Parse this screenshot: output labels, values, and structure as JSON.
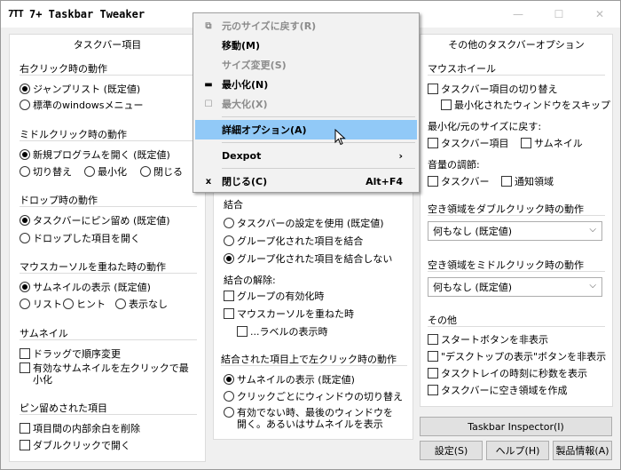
{
  "window": {
    "title": "7+ Taskbar Tweaker",
    "icon_text": "7TT"
  },
  "left": {
    "title": "タスクバー項目",
    "right_click": {
      "label": "右クリック時の動作",
      "options": [
        "ジャンプリスト (既定値)",
        "標準のwindowsメニュー"
      ]
    },
    "middle_click": {
      "label": "ミドルクリック時の動作",
      "options": [
        "新規プログラムを開く (既定値)",
        "切り替え",
        "最小化",
        "閉じる"
      ]
    },
    "drop": {
      "label": "ドロップ時の動作",
      "options": [
        "タスクバーにピン留め (既定値)",
        "ドロップした項目を開く"
      ]
    },
    "hover": {
      "label": "マウスカーソルを重ねた時の動作",
      "options": [
        "サムネイルの表示 (既定値)",
        "リスト",
        "ヒント",
        "表示なし"
      ]
    },
    "thumbnail": {
      "label": "サムネイル",
      "options": [
        "ドラッグで順序変更",
        "有効なサムネイルを左クリックで最小化"
      ]
    },
    "pinned": {
      "label": "ピン留めされた項目",
      "options": [
        "項目間の内部余白を削除",
        "ダブルクリックで開く"
      ]
    }
  },
  "middle": {
    "combine": {
      "label": "結合",
      "options": [
        "タスクバーの設定を使用 (既定値)",
        "グループ化された項目を結合",
        "グループ化された項目を結合しない"
      ]
    },
    "uncombine": {
      "label": "結合の解除:",
      "options": [
        "グループの有効化時",
        "マウスカーソルを重ねた時",
        "...ラベルの表示時"
      ]
    },
    "combined_left_click": {
      "label": "結合された項目上で左クリック時の動作",
      "options": [
        "サムネイルの表示 (既定値)",
        "クリックごとにウィンドウの切り替え",
        "有効でない時、最後のウィンドウを開く。あるいはサムネイルを表示"
      ]
    }
  },
  "right": {
    "title": "その他のタスクバーオプション",
    "mouse_wheel": {
      "label": "マウスホイール",
      "options": [
        "タスクバー項目の切り替え",
        "最小化されたウィンドウをスキップ"
      ]
    },
    "minimize_restore": {
      "label": "最小化/元のサイズに戻す:",
      "options": [
        "タスクバー項目",
        "サムネイル"
      ]
    },
    "volume": {
      "label": "音量の調節:",
      "options": [
        "タスクバー",
        "通知領域"
      ]
    },
    "double_click": {
      "label": "空き領域をダブルクリック時の動作",
      "value": "何もなし (既定値)"
    },
    "middle_click_empty": {
      "label": "空き領域をミドルクリック時の動作",
      "value": "何もなし (既定値)"
    },
    "other": {
      "label": "その他",
      "options": [
        "スタートボタンを非表示",
        "\"デスクトップの表示\"ボタンを非表示",
        "タスクトレイの時刻に秒数を表示",
        "タスクバーに空き領域を作成"
      ]
    }
  },
  "buttons": {
    "inspector": "Taskbar Inspector(I)",
    "settings": "設定(S)",
    "help": "ヘルプ(H)",
    "about": "製品情報(A)"
  },
  "context_menu": {
    "items": [
      {
        "icon": "⧉",
        "label": "元のサイズに戻す(R)",
        "shortcut": "",
        "disabled": true
      },
      {
        "icon": "",
        "label": "移動(M)",
        "shortcut": "",
        "disabled": false
      },
      {
        "icon": "",
        "label": "サイズ変更(S)",
        "shortcut": "",
        "disabled": true
      },
      {
        "icon": "▬",
        "label": "最小化(N)",
        "shortcut": "",
        "disabled": false
      },
      {
        "icon": "☐",
        "label": "最大化(X)",
        "shortcut": "",
        "disabled": true
      },
      {
        "icon": "",
        "label": "詳細オプション(A)",
        "shortcut": "",
        "disabled": false
      },
      {
        "icon": "",
        "label": "Dexpot",
        "shortcut": "›",
        "disabled": false
      },
      {
        "icon": "x",
        "label": "閉じる(C)",
        "shortcut": "Alt+F4",
        "disabled": false
      }
    ]
  },
  "colors": {
    "menu_highlight": "#91c9f7",
    "disabled_text": "#8c8c8c"
  }
}
